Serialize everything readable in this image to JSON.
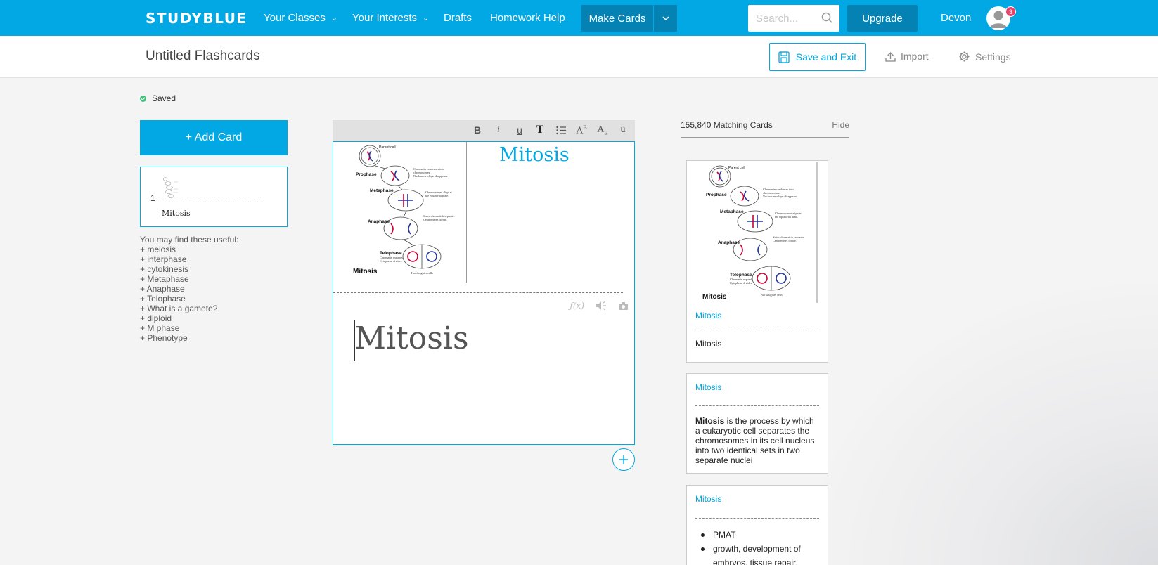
{
  "nav": {
    "logo": "STUDYBLUE",
    "links": [
      "Your Classes",
      "Your Interests",
      "Drafts",
      "Homework Help"
    ],
    "make_cards": "Make Cards",
    "search_placeholder": "Search...",
    "upgrade": "Upgrade",
    "user": "Devon",
    "notification_count": "3"
  },
  "header": {
    "title": "Untitled Flashcards",
    "save_exit": "Save and Exit",
    "import": "Import",
    "settings": "Settings"
  },
  "sidebar": {
    "status": "Saved",
    "add_card": "+ Add Card",
    "cards": [
      {
        "number": "1",
        "label": "Mitosis"
      }
    ],
    "useful_heading": "You may find these useful:",
    "useful_items": [
      "+ meiosis",
      "+ interphase",
      "+ cytokinesis",
      "+ Metaphase",
      "+ Anaphase",
      "+ Telophase",
      "+ What is a gamete?",
      "+ diploid",
      "+ M phase",
      "+ Phenotype"
    ]
  },
  "editor": {
    "toolbar": [
      "B",
      "i",
      "u",
      "T",
      "list",
      "A^B",
      "A_B",
      "ü"
    ],
    "front_text": "Mitosis",
    "back_text": "Mitosis",
    "back_tools": [
      "ƒ(x)",
      "audio",
      "camera"
    ],
    "diagram": {
      "stages": [
        "Parent cell",
        "Prophase",
        "Metaphase",
        "Anaphase",
        "Telophase",
        "Mitosis"
      ],
      "notes": [
        "Chromatin condenses into chromosomes.",
        "Nuclear envelope disappears.",
        "Chromosomes align at the equatorial plate.",
        "Sister chromatids separate.",
        "Centromeres divide.",
        "Chromatin expands.",
        "Cytoplasm divides.",
        "Two daughter cells"
      ]
    }
  },
  "matching": {
    "count": "155,840 Matching Cards",
    "hide": "Hide",
    "cards": [
      {
        "front": "Mitosis",
        "back": "Mitosis"
      },
      {
        "front": "Mitosis",
        "back_bold": "Mitosis",
        "back_rest": " is the process by which a eukaryotic cell separates the chromosomes in its cell nucleus into two identical sets in two separate nuclei"
      },
      {
        "front": "Mitosis",
        "bullets": [
          "PMAT",
          "growth, development of embryos, tissue repair,"
        ]
      }
    ]
  },
  "colors": {
    "brand": "#02a8e3",
    "brand_dark": "#0382b3",
    "badge": "#e9426a",
    "saved": "#3cc47c"
  }
}
